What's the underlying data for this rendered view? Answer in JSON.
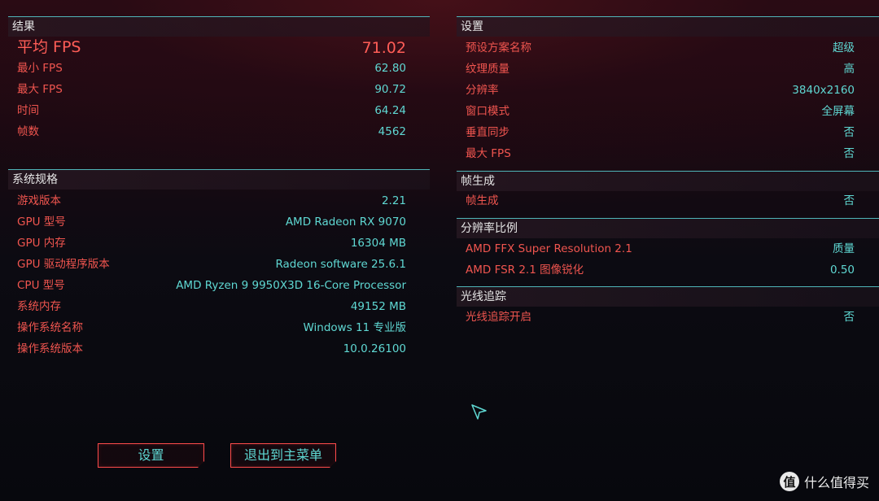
{
  "results": {
    "title": "结果",
    "avg_fps_label": "平均 FPS",
    "avg_fps_value": "71.02",
    "rows": [
      {
        "label": "最小 FPS",
        "value": "62.80"
      },
      {
        "label": "最大 FPS",
        "value": "90.72"
      },
      {
        "label": "时间",
        "value": "64.24"
      },
      {
        "label": "帧数",
        "value": "4562"
      }
    ]
  },
  "system_specs": {
    "title": "系统规格",
    "rows": [
      {
        "label": "游戏版本",
        "value": "2.21"
      },
      {
        "label": "GPU 型号",
        "value": "AMD Radeon RX 9070"
      },
      {
        "label": "GPU 内存",
        "value": "16304 MB"
      },
      {
        "label": "GPU 驱动程序版本",
        "value": "Radeon software 25.6.1"
      },
      {
        "label": "CPU 型号",
        "value": "AMD Ryzen 9 9950X3D 16-Core Processor"
      },
      {
        "label": "系统内存",
        "value": "49152 MB"
      },
      {
        "label": "操作系统名称",
        "value": "Windows 11 专业版"
      },
      {
        "label": "操作系统版本",
        "value": "10.0.26100"
      }
    ]
  },
  "settings": {
    "title": "设置",
    "rows": [
      {
        "label": "预设方案名称",
        "value": "超级"
      },
      {
        "label": "纹理质量",
        "value": "高"
      },
      {
        "label": "分辨率",
        "value": "3840x2160"
      },
      {
        "label": "窗口模式",
        "value": "全屏幕"
      },
      {
        "label": "垂直同步",
        "value": "否"
      },
      {
        "label": "最大 FPS",
        "value": "否"
      }
    ]
  },
  "frame_gen": {
    "title": "帧生成",
    "rows": [
      {
        "label": "帧生成",
        "value": "否"
      }
    ]
  },
  "resolution_scaling": {
    "title": "分辨率比例",
    "rows": [
      {
        "label": "AMD FFX Super Resolution 2.1",
        "value": "质量"
      },
      {
        "label": "AMD FSR 2.1 图像锐化",
        "value": "0.50"
      }
    ]
  },
  "ray_tracing": {
    "title": "光线追踪",
    "rows": [
      {
        "label": "光线追踪开启",
        "value": "否"
      }
    ]
  },
  "buttons": {
    "settings_label": "设置",
    "exit_label": "退出到主菜单"
  },
  "watermark": {
    "badge": "值",
    "text": "什么值得买"
  },
  "colors": {
    "accent_red": "#f0554f",
    "accent_cyan": "#5fd8d3",
    "divider": "#4fb5b8"
  }
}
